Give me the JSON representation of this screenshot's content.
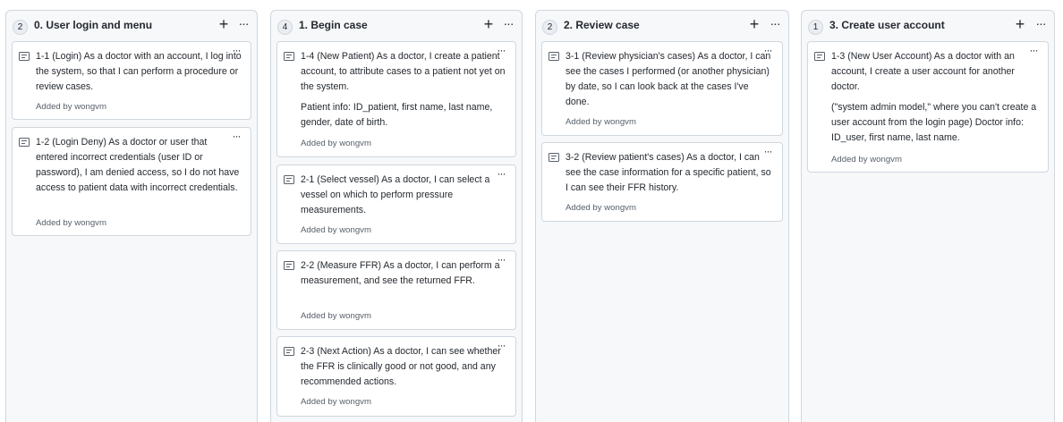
{
  "columns": [
    {
      "count": "2",
      "title": "0. User login and menu",
      "add_label": "+",
      "menu_label": "···",
      "cards": [
        {
          "text": "1-1 (Login) As a doctor with an account, I log into the system, so that I can perform a procedure or review cases.",
          "added_prefix": "Added by",
          "author": "wongvm"
        },
        {
          "text": "1-2 (Login Deny) As a doctor or user that entered incorrect credentials (user ID or password), I am denied access, so I do not have access to patient data with incorrect credentials.",
          "added_prefix": "Added by",
          "author": "wongvm"
        }
      ]
    },
    {
      "count": "4",
      "title": "1. Begin case",
      "add_label": "+",
      "menu_label": "···",
      "cards": [
        {
          "text": "1-4 (New Patient) As a doctor, I create a patient account, to attribute cases to a patient not yet on the system.",
          "text2": "Patient info: ID_patient, first name, last name, gender, date of birth.",
          "added_prefix": "Added by",
          "author": "wongvm"
        },
        {
          "text": "2-1 (Select vessel) As a doctor, I can select a vessel on which to perform pressure measurements.",
          "added_prefix": "Added by",
          "author": "wongvm"
        },
        {
          "text": "2-2 (Measure FFR) As a doctor, I can perform a measurement, and see the returned FFR.",
          "added_prefix": "Added by",
          "author": "wongvm"
        },
        {
          "text": "2-3 (Next Action) As a doctor, I can see whether the FFR is clinically good or not good, and any recommended actions.",
          "added_prefix": "Added by",
          "author": "wongvm"
        }
      ]
    },
    {
      "count": "2",
      "title": "2. Review case",
      "add_label": "+",
      "menu_label": "···",
      "cards": [
        {
          "text": "3-1 (Review physician's cases) As a doctor, I can see the cases I performed (or another physician) by date, so I can look back at the cases I've done.",
          "added_prefix": "Added by",
          "author": "wongvm"
        },
        {
          "text": "3-2 (Review patient's cases) As a doctor, I can see the case information for a specific patient, so I can see their FFR history.",
          "added_prefix": "Added by",
          "author": "wongvm"
        }
      ]
    },
    {
      "count": "1",
      "title": "3. Create user account",
      "add_label": "+",
      "menu_label": "···",
      "cards": [
        {
          "text": "1-3 (New User Account) As a doctor with an account, I create a user account for another doctor.",
          "text2": "(\"system admin model,\" where you can't create a user account from the login page) Doctor info: ID_user, first name, last name.",
          "added_prefix": "Added by",
          "author": "wongvm"
        }
      ]
    }
  ],
  "card_menu_label": "···"
}
